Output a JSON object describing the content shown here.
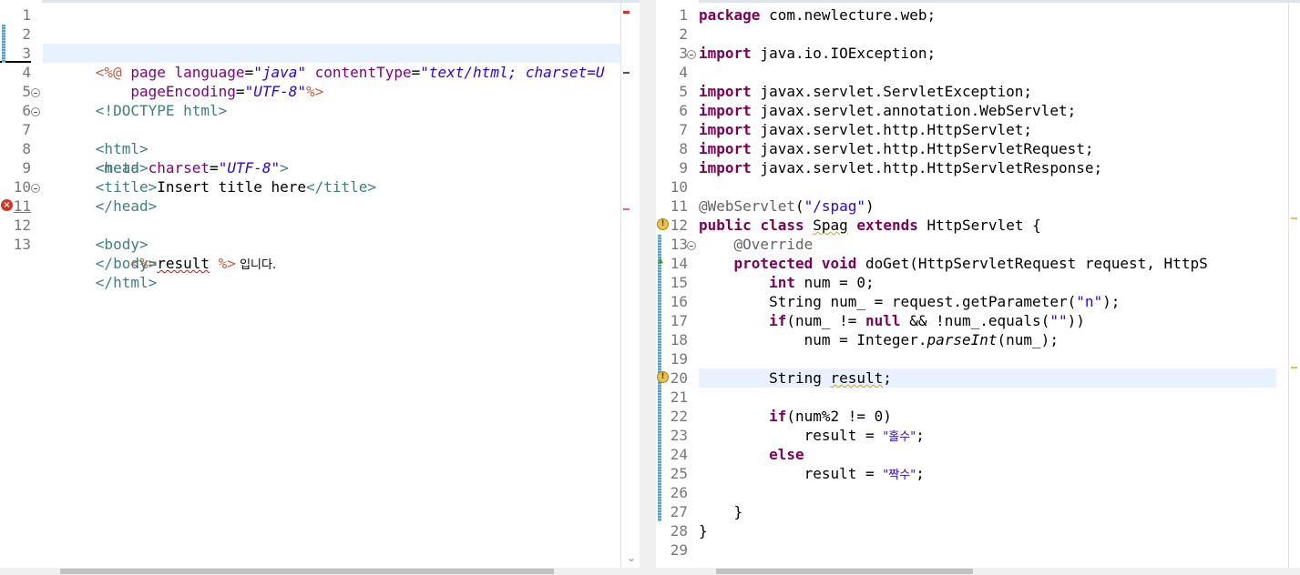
{
  "left_editor": {
    "lines": [
      {
        "n": "1"
      },
      {
        "n": "2"
      },
      {
        "n": "3"
      },
      {
        "n": "4"
      },
      {
        "n": "5"
      },
      {
        "n": "6"
      },
      {
        "n": "7"
      },
      {
        "n": "8"
      },
      {
        "n": "9"
      },
      {
        "n": "10"
      },
      {
        "n": "11"
      },
      {
        "n": "12"
      },
      {
        "n": "13"
      }
    ],
    "text": {
      "l1_open": "<%@",
      "l1_page": " page ",
      "l1_language": "language",
      "l1_eq": "=",
      "l1_lang_val": "\"java\"",
      "l1_ct": "contentType",
      "l1_ct_val": "\"text/html; charset=U",
      "l2_pe": "pageEncoding",
      "l2_pe_val": "\"UTF-8\"",
      "l2_close": "%>",
      "l4": "<!DOCTYPE html>",
      "l5": "<html>",
      "l6": "<head>",
      "l7_tag": "<meta",
      "l7_attr": "charset",
      "l7_val": "\"UTF-8\"",
      "l7_end": ">",
      "l8_open": "<title>",
      "l8_text": "Insert title here",
      "l8_close": "</title>",
      "l9": "</head>",
      "l10": "<body>",
      "l11_open": "<%=",
      "l11_expr": "result",
      "l11_close": "%>",
      "l11_text": " 입니다.",
      "l12": "</body>",
      "l13": "</html>"
    }
  },
  "right_editor": {
    "lines": [
      {
        "n": "1"
      },
      {
        "n": "2"
      },
      {
        "n": "3"
      },
      {
        "n": "4"
      },
      {
        "n": "5"
      },
      {
        "n": "6"
      },
      {
        "n": "7"
      },
      {
        "n": "8"
      },
      {
        "n": "9"
      },
      {
        "n": "10"
      },
      {
        "n": "11"
      },
      {
        "n": "12"
      },
      {
        "n": "13"
      },
      {
        "n": "14"
      },
      {
        "n": "15"
      },
      {
        "n": "16"
      },
      {
        "n": "17"
      },
      {
        "n": "18"
      },
      {
        "n": "19"
      },
      {
        "n": "20"
      },
      {
        "n": "21"
      },
      {
        "n": "22"
      },
      {
        "n": "23"
      },
      {
        "n": "24"
      },
      {
        "n": "25"
      },
      {
        "n": "26"
      },
      {
        "n": "27"
      },
      {
        "n": "28"
      },
      {
        "n": "29"
      }
    ],
    "text": {
      "kw_package": "package",
      "l1_rest": " com.newlecture.web;",
      "kw_import": "import",
      "l3_rest": " java.io.IOException;",
      "l5_rest": " javax.servlet.ServletException;",
      "l6_rest": " javax.servlet.annotation.WebServlet;",
      "l7_rest": " javax.servlet.http.HttpServlet;",
      "l8_rest": " javax.servlet.http.HttpServletRequest;",
      "l9_rest": " javax.servlet.http.HttpServletResponse;",
      "l11_ann": "@WebServlet",
      "l11_p1": "(",
      "l11_str": "\"/spag\"",
      "l11_p2": ")",
      "kw_public": "public",
      "kw_class": "class",
      "l12_name": "Spag",
      "kw_extends": "extends",
      "l12_rest": " HttpServlet {",
      "l13_ann": "@Override",
      "kw_protected": "protected",
      "kw_void": "void",
      "l14_rest": " doGet(HttpServletRequest request, HttpS",
      "kw_int": "int",
      "l15_rest": " num = 0;",
      "l16_rest": "String num_ = request.getParameter(",
      "l16_str": "\"n\"",
      "l16_end": ");",
      "kw_if": "if",
      "l17_a": "(num_ != ",
      "kw_null": "null",
      "l17_b": " && !num_.equals(",
      "l17_str": "\"\"",
      "l17_c": "))",
      "l18_a": "num = Integer.",
      "l18_m": "parseInt",
      "l18_b": "(num_);",
      "l20_a": "String ",
      "l20_var": "result",
      "l20_b": ";",
      "l22_rest": "(num%2 != 0)",
      "l23_a": "result = ",
      "l23_str": "\"홀수\"",
      "l23_b": ";",
      "kw_else": "else",
      "l25_a": "result = ",
      "l25_str": "\"짝수\"",
      "l25_b": ";",
      "l27": "}",
      "l28": "}"
    }
  },
  "icons": {
    "error": "error-icon",
    "warning": "warning-icon",
    "fold": "fold-collapse-icon",
    "override": "override-triangle-icon"
  },
  "colors": {
    "keyword": "#7f0055",
    "string": "#2a00ff",
    "annotation": "#646464",
    "html_tag": "#3f7f7f",
    "current_line": "#e8f2fe"
  }
}
